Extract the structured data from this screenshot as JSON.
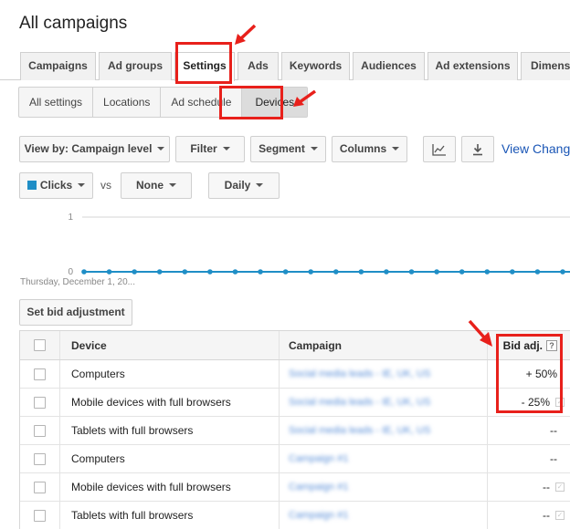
{
  "page": {
    "title": "All campaigns"
  },
  "tabs": [
    {
      "label": "Campaigns"
    },
    {
      "label": "Ad groups"
    },
    {
      "label": "Settings"
    },
    {
      "label": "Ads"
    },
    {
      "label": "Keywords"
    },
    {
      "label": "Audiences"
    },
    {
      "label": "Ad extensions"
    },
    {
      "label": "Dimensi"
    }
  ],
  "subtabs": [
    {
      "label": "All settings"
    },
    {
      "label": "Locations"
    },
    {
      "label": "Ad schedule"
    },
    {
      "label": "Devices"
    }
  ],
  "toolbar": {
    "view_by": "View by: Campaign level",
    "filter": "Filter",
    "segment": "Segment",
    "columns": "Columns",
    "view_change": "View Change"
  },
  "chart_controls": {
    "metric1": "Clicks",
    "vs": "vs",
    "metric2": "None",
    "period": "Daily"
  },
  "colors": {
    "accent": "#1f8ec6",
    "annotation": "#e8201b",
    "link": "#1a56b6"
  },
  "chart_data": {
    "type": "line",
    "series": [
      {
        "name": "Clicks",
        "values": [
          0,
          0,
          0,
          0,
          0,
          0,
          0,
          0,
          0,
          0,
          0,
          0,
          0,
          0,
          0,
          0,
          0,
          0,
          0,
          0
        ]
      }
    ],
    "ylim": [
      0,
      1
    ],
    "yticks": [
      "1",
      "0"
    ],
    "xlabel_start": "Thursday, December 1, 20..."
  },
  "actions": {
    "set_bid": "Set bid adjustment"
  },
  "table": {
    "headers": {
      "device": "Device",
      "campaign": "Campaign",
      "bid": "Bid adj.",
      "help": "?"
    },
    "rows": [
      {
        "device": "Computers",
        "campaign": "Social media leads - IE, UK, US",
        "bid": "+ 50%"
      },
      {
        "device": "Mobile devices with full browsers",
        "campaign": "Social media leads - IE, UK, US",
        "bid": "- 25%"
      },
      {
        "device": "Tablets with full browsers",
        "campaign": "Social media leads - IE, UK, US",
        "bid": "--"
      },
      {
        "device": "Computers",
        "campaign": "Campaign #1",
        "bid": "--"
      },
      {
        "device": "Mobile devices with full browsers",
        "campaign": "Campaign #1",
        "bid": "--"
      },
      {
        "device": "Tablets with full browsers",
        "campaign": "Campaign #1",
        "bid": "--"
      }
    ]
  }
}
